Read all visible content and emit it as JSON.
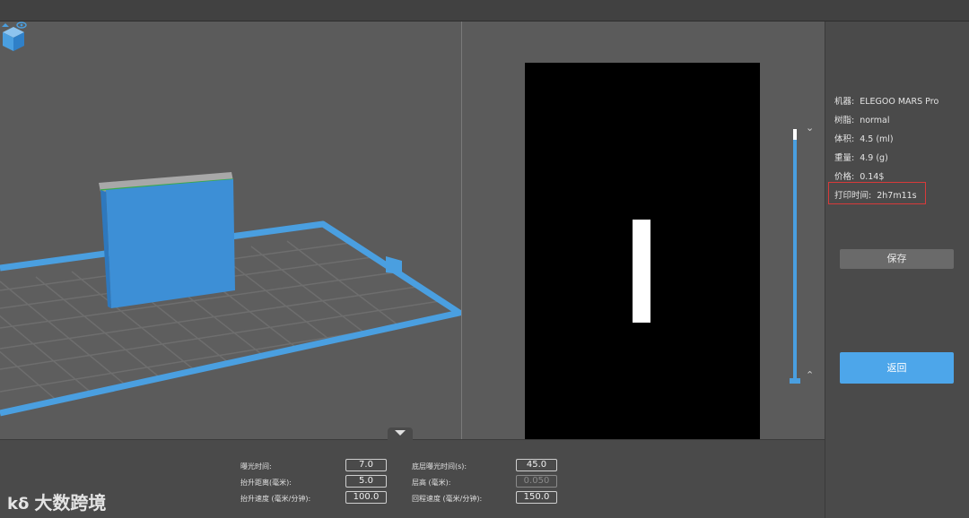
{
  "info": {
    "machine_label": "机器:",
    "machine_value": "ELEGOO MARS Pro",
    "resin_label": "树脂:",
    "resin_value": "normal",
    "volume_label": "体积:",
    "volume_value": "4.5  (ml)",
    "weight_label": "重量:",
    "weight_value": "4.9  (g)",
    "price_label": "价格:",
    "price_value": "0.14$",
    "time_label": "打印时间:",
    "time_value": "2h7m11s"
  },
  "buttons": {
    "save": "保存",
    "back": "返回"
  },
  "params": {
    "exposure_label": "曝光时间:",
    "exposure_value": "7.0",
    "lift_distance_label": "抬升距离(毫米):",
    "lift_distance_value": "5.0",
    "lift_speed_label": "抬升速度 (毫米/分钟):",
    "lift_speed_value": "100.0",
    "bottom_exposure_label": "底层曝光时间(s):",
    "bottom_exposure_value": "45.0",
    "layer_height_label": "层高 (毫米):",
    "layer_height_value": "0.050",
    "retract_speed_label": "回程速度 (毫米/分钟):",
    "retract_speed_value": "150.0"
  },
  "layer_slider": {
    "position": 1.0
  },
  "icons": {
    "view_cube": "view-cube-icon",
    "slider_up": "chevron-down-icon",
    "slider_down": "chevron-up-icon",
    "expand_panel": "triangle-down-icon"
  },
  "watermark": {
    "logo": "kδ",
    "text": "大数跨境"
  },
  "colors": {
    "accent": "#4da6ea",
    "model": "#3d8fd6",
    "highlight": "#d83a3a"
  }
}
